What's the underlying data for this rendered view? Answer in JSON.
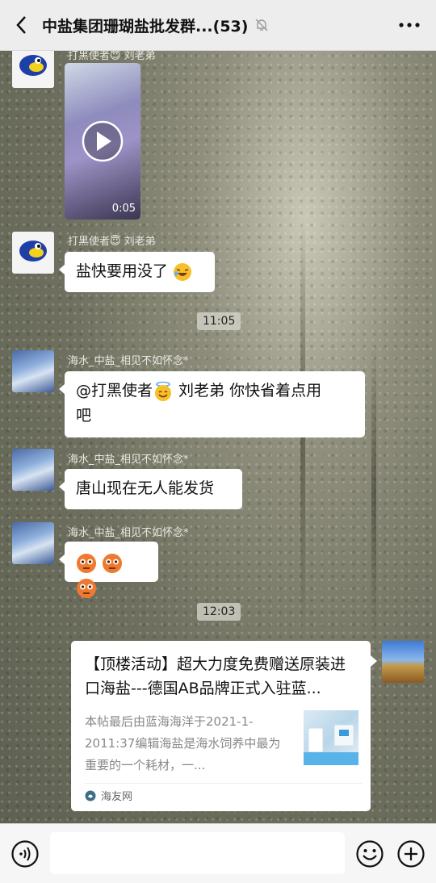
{
  "header": {
    "title": "中盐集团珊瑚盐批发群...(53)"
  },
  "messages": {
    "m1": {
      "sender": "打黑使者😇 刘老弟",
      "video_duration": "0:05"
    },
    "m2": {
      "sender": "打黑使者😇 刘老弟",
      "text": "盐快要用没了"
    },
    "t1": "11:05",
    "m3": {
      "sender": "海水_中盐_相见不如怀念*",
      "line1": "@打黑使者",
      "line1b": " 刘老弟  你快省着点用",
      "line2": "吧"
    },
    "m4": {
      "sender": "海水_中盐_相见不如怀念*",
      "text": "唐山现在无人能发货"
    },
    "m5": {
      "sender": "海水_中盐_相见不如怀念*"
    },
    "t2": "12:03",
    "card": {
      "title": "【顶楼活动】超大力度免费赠送原装进口海盐---德国AB品牌正式入驻蓝...",
      "desc": "本帖最后由蓝海海洋于2021-1-2011:37编辑海盐是海水饲养中最为重要的一个耗材，一...",
      "source": "海友网"
    }
  },
  "icons": {
    "back": "chevron-left-icon",
    "mute": "bell-off-icon",
    "more": "more-dots-icon",
    "voice": "voice-icon",
    "emoji": "emoji-icon",
    "add": "add-icon"
  }
}
